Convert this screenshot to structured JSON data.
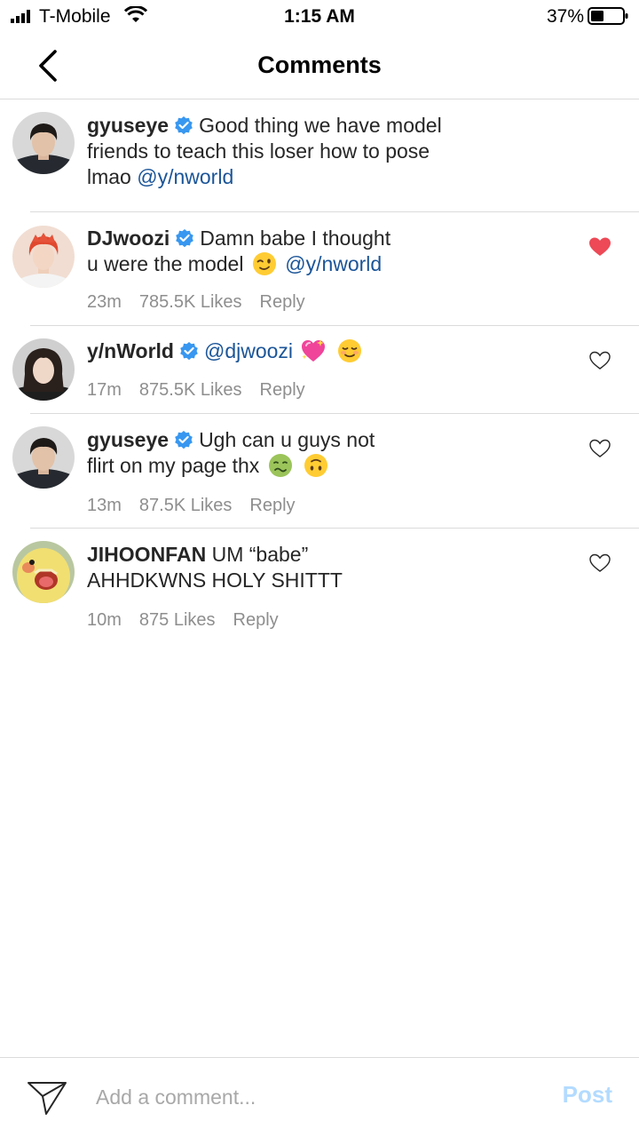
{
  "status_bar": {
    "carrier": "T-Mobile",
    "time": "1:15 AM",
    "battery": "37%"
  },
  "header": {
    "title": "Comments"
  },
  "comments": [
    {
      "username": "gyuseye",
      "verified": true,
      "text_1": "Good thing we have model",
      "text_2": "friends to teach this loser how to pose",
      "text_3_pre": "lmao ",
      "mention": "@y/nworld",
      "liked": false
    },
    {
      "username": "DJwoozi",
      "verified": true,
      "text_1": "Damn babe I thought",
      "text_2": "u were the model",
      "mention": "@y/nworld",
      "emoji": "winking-face-emoji",
      "time": "23m",
      "likes": "785.5K Likes",
      "reply": "Reply",
      "liked": true
    },
    {
      "username": "y/nWorld",
      "verified": true,
      "mention": "@djwoozi",
      "emojis": [
        "sparkling-heart-emoji",
        "smiling-face-emoji"
      ],
      "time": "17m",
      "likes": "875.5K Likes",
      "reply": "Reply",
      "liked": false
    },
    {
      "username": "gyuseye",
      "verified": true,
      "text_1": "Ugh can u guys not",
      "text_2": "flirt on my page thx",
      "emojis": [
        "nauseated-face-emoji",
        "upside-down-face-emoji"
      ],
      "time": "13m",
      "likes": "87.5K Likes",
      "reply": "Reply",
      "liked": false
    },
    {
      "username": "JIHOONFAN",
      "verified": false,
      "text_1": "UM “babe”",
      "text_2": "AHHDKWNS HOLY SHITTT",
      "time": "10m",
      "likes": "875 Likes",
      "reply": "Reply",
      "liked": false
    }
  ],
  "composer": {
    "placeholder": "Add a comment...",
    "post_label": "Post"
  },
  "colors": {
    "mention": "#1b5598",
    "verified": "#3897f0",
    "liked_heart": "#ed4956",
    "post_disabled": "#b3dbff"
  }
}
